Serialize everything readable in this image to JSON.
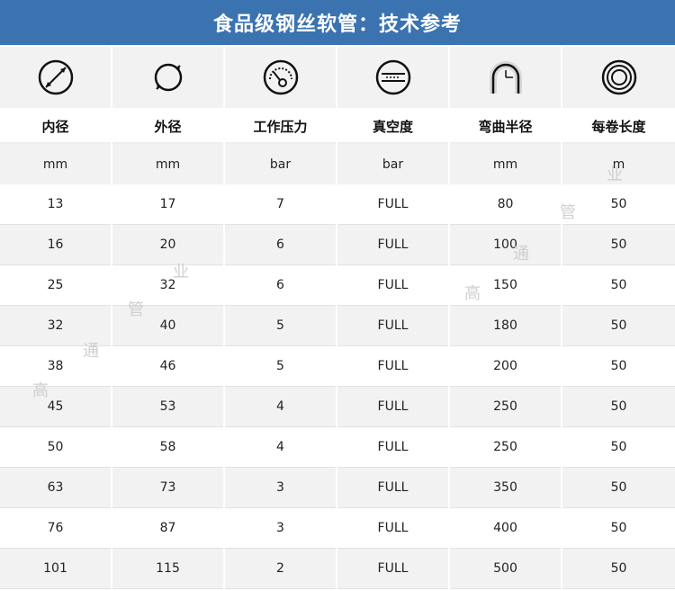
{
  "title": "食品级钢丝软管：技术参考",
  "icons": [
    "inner-diameter-icon",
    "outer-diameter-icon",
    "pressure-gauge-icon",
    "vacuum-icon",
    "bend-radius-icon",
    "coil-icon"
  ],
  "headers": [
    "内径",
    "外径",
    "工作压力",
    "真空度",
    "弯曲半径",
    "每卷长度"
  ],
  "units": [
    "mm",
    "mm",
    "bar",
    "bar",
    "mm",
    "m"
  ],
  "rows": [
    [
      "13",
      "17",
      "7",
      "FULL",
      "80",
      "50"
    ],
    [
      "16",
      "20",
      "6",
      "FULL",
      "100",
      "50"
    ],
    [
      "25",
      "32",
      "6",
      "FULL",
      "150",
      "50"
    ],
    [
      "32",
      "40",
      "5",
      "FULL",
      "180",
      "50"
    ],
    [
      "38",
      "46",
      "5",
      "FULL",
      "200",
      "50"
    ],
    [
      "45",
      "53",
      "4",
      "FULL",
      "250",
      "50"
    ],
    [
      "50",
      "58",
      "4",
      "FULL",
      "250",
      "50"
    ],
    [
      "63",
      "73",
      "3",
      "FULL",
      "350",
      "50"
    ],
    [
      "76",
      "87",
      "3",
      "FULL",
      "400",
      "50"
    ],
    [
      "101",
      "115",
      "2",
      "FULL",
      "500",
      "50"
    ]
  ],
  "watermark": [
    "高",
    "通",
    "管",
    "业"
  ]
}
